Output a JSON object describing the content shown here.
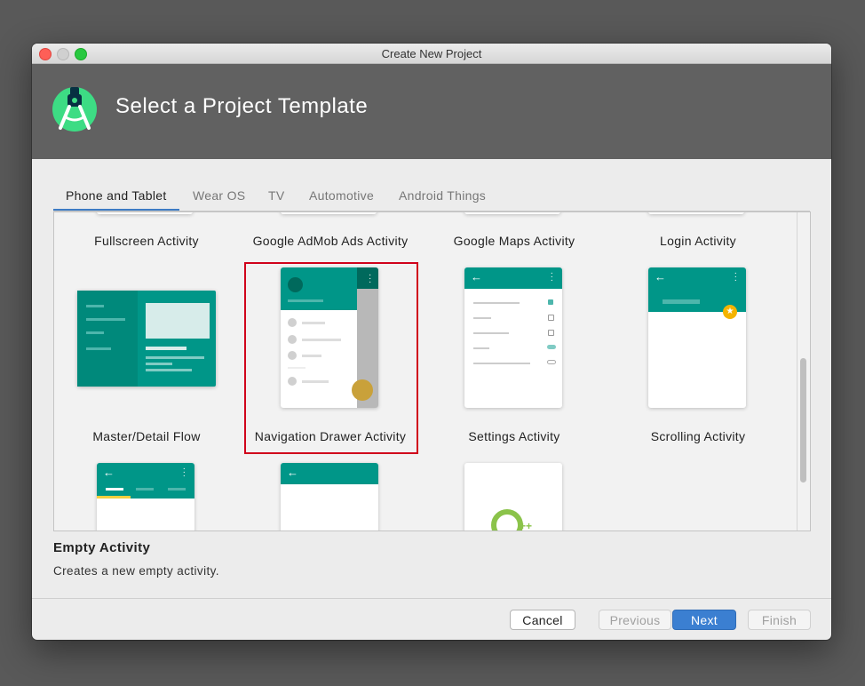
{
  "window": {
    "title": "Create New Project"
  },
  "header": {
    "title": "Select a Project Template"
  },
  "tabs": [
    {
      "label": "Phone and Tablet",
      "active": true
    },
    {
      "label": "Wear OS",
      "active": false
    },
    {
      "label": "TV",
      "active": false
    },
    {
      "label": "Automotive",
      "active": false
    },
    {
      "label": "Android Things",
      "active": false
    }
  ],
  "templates": {
    "row1": [
      "Fullscreen Activity",
      "Google AdMob Ads Activity",
      "Google Maps Activity",
      "Login Activity"
    ],
    "row2": [
      "Master/Detail Flow",
      "Navigation Drawer Activity",
      "Settings Activity",
      "Scrolling Activity"
    ],
    "selected": "Navigation Drawer Activity"
  },
  "description": {
    "title": "Empty Activity",
    "text": "Creates a new empty activity."
  },
  "buttons": {
    "cancel": "Cancel",
    "previous": "Previous",
    "next": "Next",
    "finish": "Finish"
  },
  "colors": {
    "teal": "#009688",
    "accent_blue": "#3b7fd1",
    "selection_red": "#d0021b",
    "fab_yellow": "#f4b400"
  }
}
